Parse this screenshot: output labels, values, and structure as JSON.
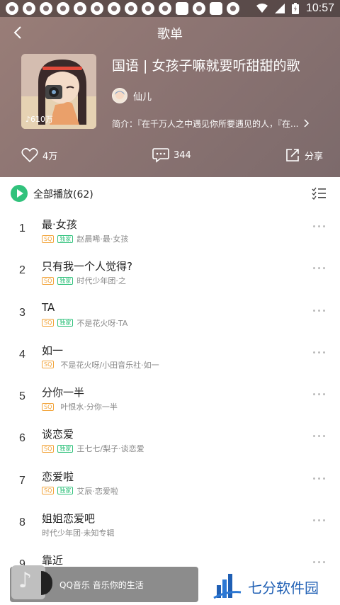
{
  "status_bar": {
    "time": "10:57"
  },
  "header": {
    "page_title": "歌单",
    "playlist_title": "国语 | 女孩子嘛就要听甜甜的歌",
    "play_count": "610万",
    "creator_name": "仙儿",
    "intro": "简介：『在千万人之中遇见你所要遇见的人，『在...",
    "likes": "4万",
    "comments": "344",
    "share_label": "分享"
  },
  "play_all": {
    "label": "全部播放(62)"
  },
  "songs": [
    {
      "index": "1",
      "title": "最·女孩",
      "sq": "SQ",
      "exclusive": "独家",
      "meta": "赵晨唏·最·女孩"
    },
    {
      "index": "2",
      "title": "只有我一个人觉得?",
      "sq": "SQ",
      "exclusive": "独家",
      "meta": "时代少年团·之"
    },
    {
      "index": "3",
      "title": "TA",
      "sq": "SQ",
      "exclusive": "独家",
      "meta": "不是花火呀·TA"
    },
    {
      "index": "4",
      "title": "如一",
      "sq": "SQ",
      "meta": "不是花火呀/小田音乐社·如一"
    },
    {
      "index": "5",
      "title": "分你一半",
      "sq": "SQ",
      "meta": "叶恨水·分你一半"
    },
    {
      "index": "6",
      "title": "谈恋爱",
      "sq": "SQ",
      "exclusive": "独家",
      "meta": "王七七/梨子·谈恋爱"
    },
    {
      "index": "7",
      "title": "恋爱啦",
      "sq": "SQ",
      "exclusive": "独家",
      "meta": "艾辰·恋爱啦"
    },
    {
      "index": "8",
      "title": "姐姐恋爱吧",
      "meta": "时代少年团·未知专辑"
    },
    {
      "index": "9",
      "title": "靠近"
    }
  ],
  "mini_player": {
    "text": "QQ音乐 音乐你的生活"
  },
  "watermark": {
    "text": "七分软件园"
  },
  "colors": {
    "accent": "#31c27c",
    "header_bg": "#8c7472",
    "sq_tag": "#f2a43a",
    "watermark_blue": "#1f5fb4"
  }
}
